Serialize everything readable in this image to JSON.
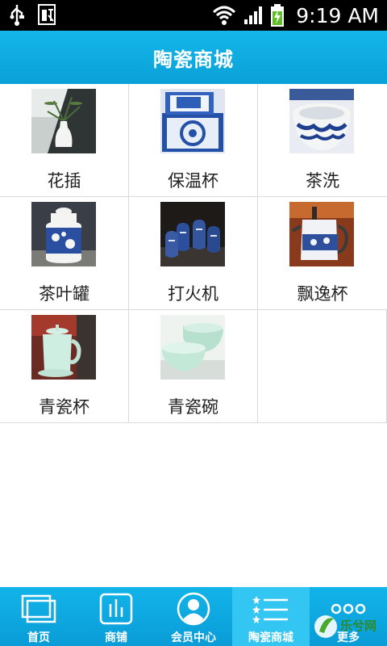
{
  "status_bar": {
    "time": "9:19 AM"
  },
  "header": {
    "title": "陶瓷商城"
  },
  "products": [
    {
      "label": "花插",
      "icon": "vase-photo"
    },
    {
      "label": "保温杯",
      "icon": "gift-box-photo"
    },
    {
      "label": "茶洗",
      "icon": "bowl-photo"
    },
    {
      "label": "茶叶罐",
      "icon": "tea-canister-photo"
    },
    {
      "label": "打火机",
      "icon": "lighter-photo"
    },
    {
      "label": "飘逸杯",
      "icon": "teapot-photo"
    },
    {
      "label": "青瓷杯",
      "icon": "celadon-cup-photo"
    },
    {
      "label": "青瓷碗",
      "icon": "celadon-bowl-photo"
    }
  ],
  "tabbar": {
    "items": [
      {
        "label": "首页",
        "icon": "window-icon"
      },
      {
        "label": "商铺",
        "icon": "bar-chart-icon"
      },
      {
        "label": "会员中心",
        "icon": "user-icon"
      },
      {
        "label": "陶瓷商城",
        "icon": "list-icon"
      },
      {
        "label": "更多",
        "icon": "more-dots-icon"
      }
    ],
    "active_index": 3
  },
  "watermark": {
    "text": "乐兮网"
  },
  "colors": {
    "accent": "#0aa8df",
    "active_tab": "#33c6f2"
  }
}
